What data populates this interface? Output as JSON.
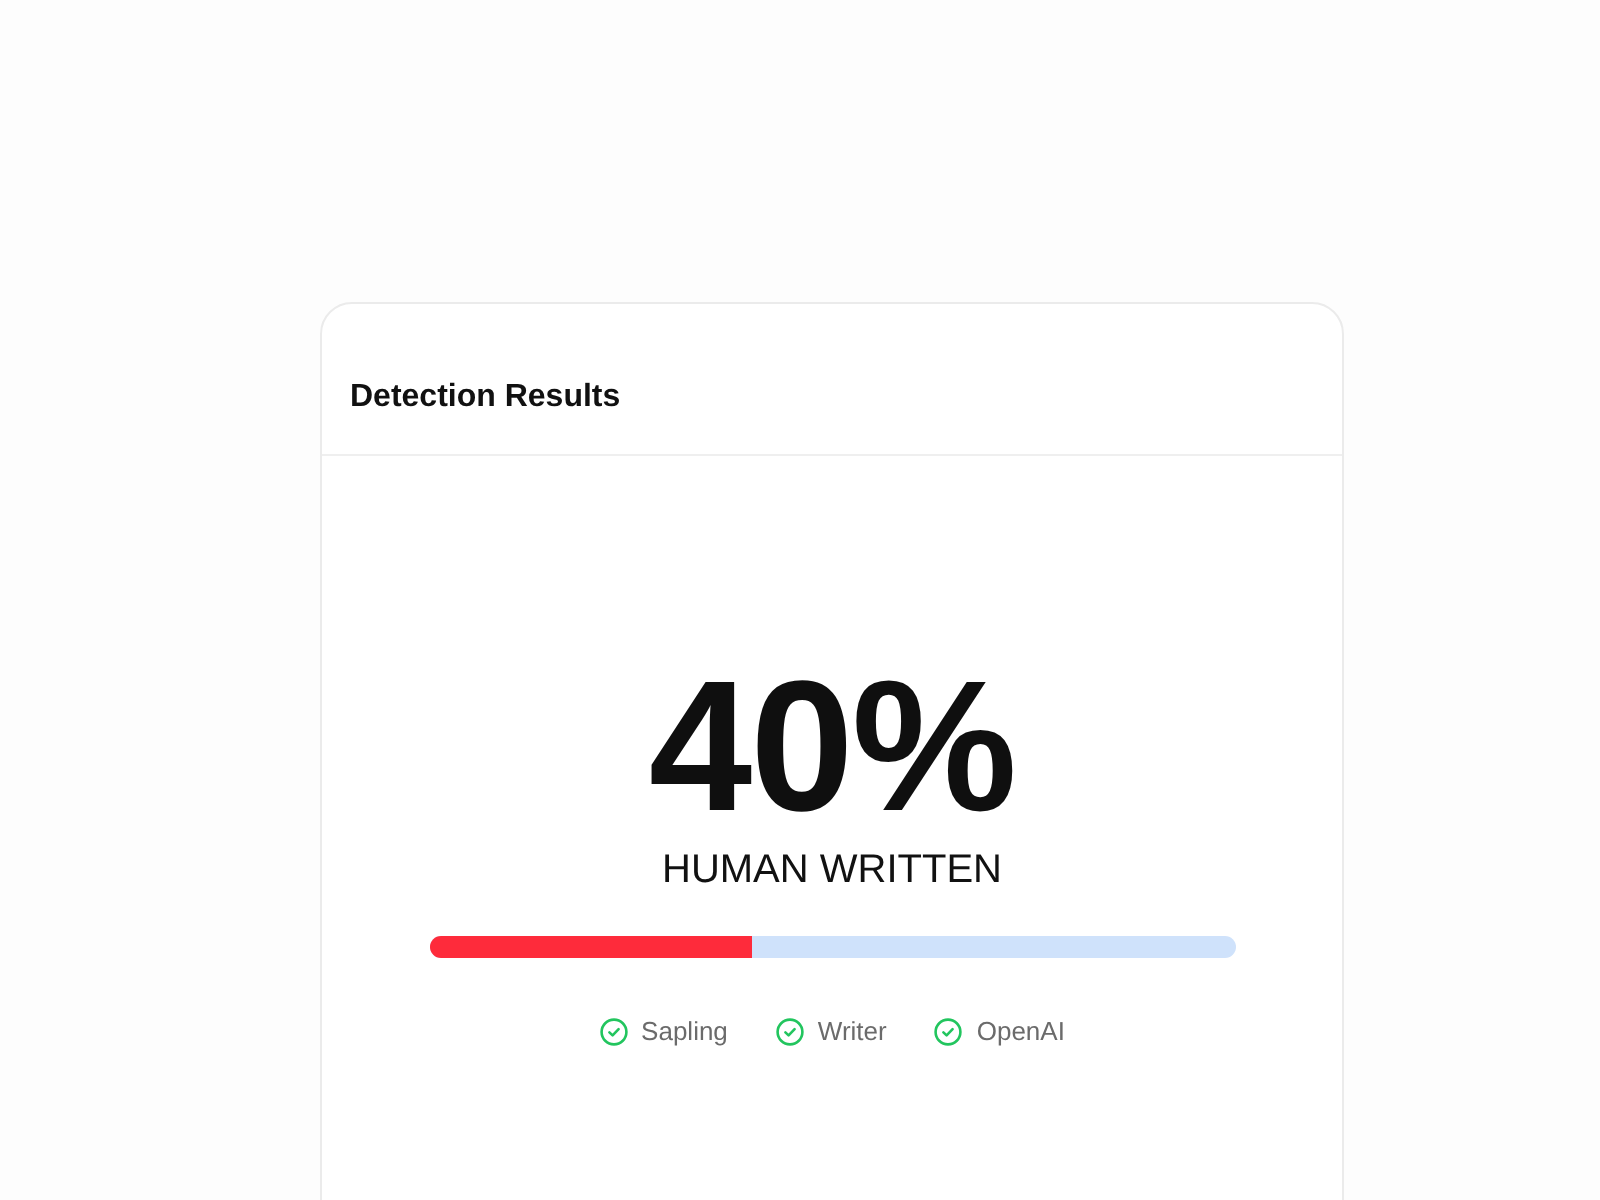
{
  "card": {
    "title": "Detection Results"
  },
  "result": {
    "score": "40%",
    "label": "HUMAN WRITTEN",
    "level": 0.4
  },
  "detectors": [
    {
      "name": "Sapling",
      "checked": true
    },
    {
      "name": "Writer",
      "checked": true
    },
    {
      "name": "OpenAI",
      "checked": true
    }
  ]
}
